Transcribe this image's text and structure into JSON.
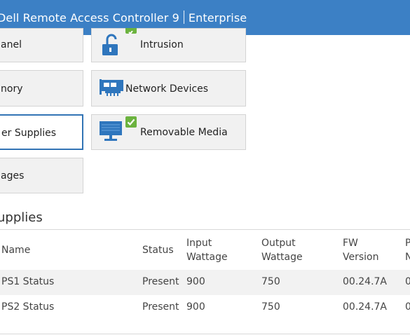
{
  "header": {
    "title_left": "Dell Remote Access Controller 9",
    "title_right": "Enterprise",
    "color": "#3c80c5"
  },
  "tiles": {
    "front_panel": "anel",
    "memory": "nory",
    "power_supplies": "er Supplies",
    "voltages": "ages",
    "intrusion": "Intrusion",
    "network_devices": "Network Devices",
    "removable_media": "Removable Media"
  },
  "section": {
    "title": "upplies"
  },
  "table": {
    "headers": {
      "name": "Name",
      "status": "Status",
      "input_wattage_1": "Input",
      "input_wattage_2": "Wattage",
      "output_wattage_1": "Output",
      "output_wattage_2": "Wattage",
      "fw_version_1": "FW",
      "fw_version_2": "Version",
      "part_1": "P",
      "part_2": "N"
    },
    "rows": [
      {
        "name": "PS1 Status",
        "status": "Present",
        "input": "900",
        "output": "750",
        "fw": "00.24.7A",
        "part": "0"
      },
      {
        "name": "PS2 Status",
        "status": "Present",
        "input": "900",
        "output": "750",
        "fw": "00.24.7A",
        "part": "0"
      }
    ]
  },
  "colors": {
    "accent": "#3c80c5",
    "selected_border": "#3274b5",
    "ok_check": "#6cb33f",
    "icon_blue": "#2f76bd"
  },
  "icons": [
    "padlock-icon",
    "network-card-icon",
    "monitor-icon",
    "check-icon"
  ]
}
